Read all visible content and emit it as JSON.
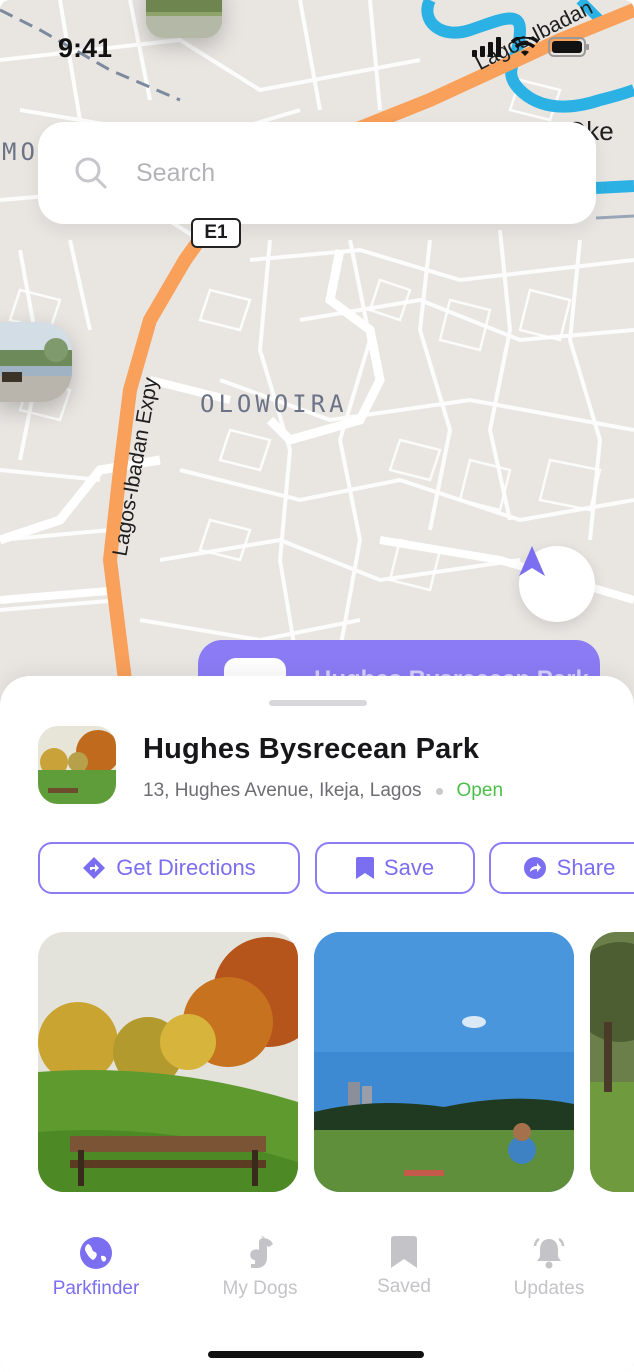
{
  "status_bar": {
    "time": "9:41"
  },
  "map": {
    "labels": {
      "area": "OLOWOIRA",
      "road_west": "Lagos-Ibadan Expy",
      "road_north": "Lagos-Ibadan",
      "route_badge": "E1",
      "edge_left": "MO",
      "edge_right": "Oke"
    }
  },
  "search": {
    "placeholder": "Search"
  },
  "preview_card": {
    "partial_text": "Hughes Bysrecean Park"
  },
  "park": {
    "name": "Hughes Bysrecean Park",
    "address": "13, Hughes Avenue, Ikeja, Lagos",
    "status": "Open"
  },
  "actions": {
    "directions_label": "Get Directions",
    "save_label": "Save",
    "share_label": "Share"
  },
  "tabs": [
    {
      "label": "Parkfinder",
      "icon": "globe-icon",
      "active": true
    },
    {
      "label": "My Dogs",
      "icon": "dog-icon",
      "active": false
    },
    {
      "label": "Saved",
      "icon": "bookmark-icon",
      "active": false
    },
    {
      "label": "Updates",
      "icon": "bell-icon",
      "active": false
    }
  ],
  "colors": {
    "accent": "#8b7cf6",
    "open": "#4cbf4a",
    "expressway": "#f9a05a",
    "river": "#2bb1e4"
  }
}
